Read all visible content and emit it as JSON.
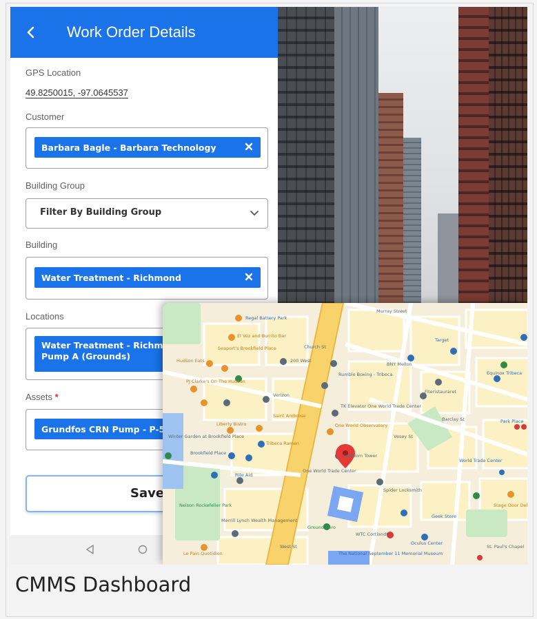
{
  "app": {
    "title": "Work Order Details",
    "back_icon": "chevron-left-icon",
    "accent": "#1a73e8"
  },
  "form": {
    "gps": {
      "label": "GPS Location",
      "value": "49.8250015, -97.0645537"
    },
    "customer": {
      "label": "Customer",
      "chip": "Barbara Bagle - Barbara Technology"
    },
    "building_group": {
      "label": "Building Group",
      "placeholder": "Filter By Building Group"
    },
    "building": {
      "label": "Building",
      "chip": "Water Treatment - Richmond"
    },
    "locations": {
      "label": "Locations",
      "chip_line1": "Water Treatment - Richmo",
      "chip_line2": "Pump A (Grounds)"
    },
    "assets": {
      "label": "Assets",
      "required_mark": "*",
      "chip": "Grundfos CRN Pump - P-50"
    },
    "save_label": "Save"
  },
  "map_labels": {
    "l1": "Regal Battery Park",
    "l2": "El Vez and Burrito Bar",
    "l3": "Seaport's Brookfield Place",
    "l4": "200 West",
    "l5": "Hudson Eats",
    "l6": "PJ Clarke's On The Hudson",
    "l7": "Le Pain Quotidien",
    "l8": "Liberty Bistro",
    "l9": "Brookfield Place",
    "l10": "Winter Garden at Brookfield Place",
    "l11": "Rite Aid",
    "l12": "Nelson Rockefeller Park",
    "l13": "Merrill Lynch Wealth Management",
    "l14": "One World Trade Center",
    "l15": "One World Observatory",
    "l16": "Freedom Tower",
    "l17": "World Trade Center",
    "l18": "Ground Zero",
    "l19": "WTC Cortlandt",
    "l20": "The National September 11 Memorial Museum",
    "l21": "Oculus Center",
    "l22": "Spider Locksmith",
    "l23": "Equinox Tribeca",
    "l24": "Target",
    "l25": "Park Place",
    "l26": "St. Paul's Chapel",
    "l27": "Tribeca Ramen",
    "l28": "Rumble Boxing - Tribeca",
    "l29": "Church St",
    "l30": "West St",
    "l31": "Barclay St",
    "l32": "BNY Mellon",
    "l33": "TK Elevator One World Trade Center",
    "l34": "Saint Ambrose",
    "l35": "Verizon",
    "l36": "Geek Store",
    "l37": "Stage Door Deli",
    "l38": "Murray Street",
    "l39": "Vesey St",
    "l40": "Fiteristauraret"
  },
  "caption": "CMMS Dashboard"
}
